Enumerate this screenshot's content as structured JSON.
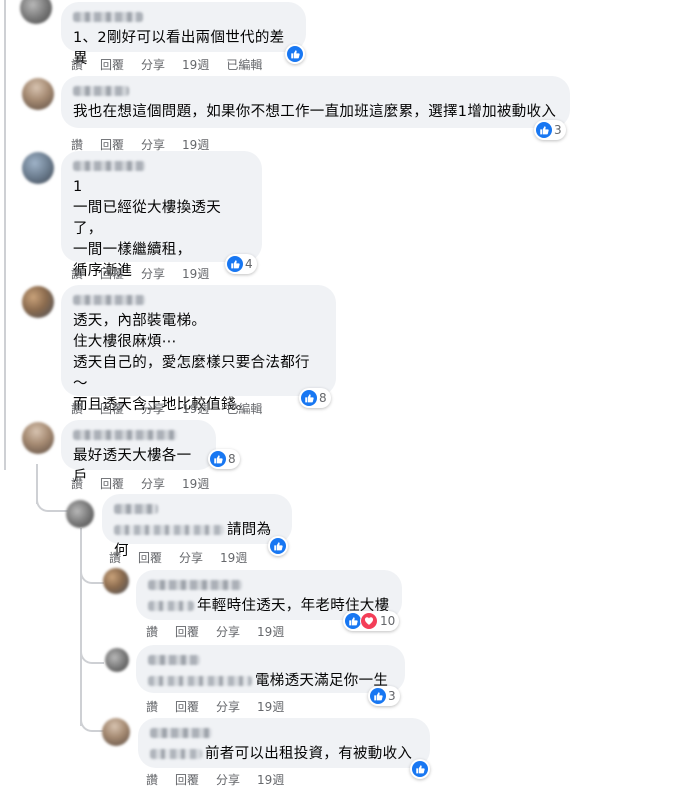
{
  "actions": {
    "like": "讚",
    "reply": "回覆",
    "share": "分享",
    "edited": "已編輯"
  },
  "comments": [
    {
      "time": "19週",
      "text": "1、2剛好可以看出兩個世代的差異",
      "reactions": "",
      "edited": true
    },
    {
      "time": "19週",
      "text": "我也在想這個問題，如果你不想工作一直加班這麼累，選擇1增加被動收入",
      "reactions": "3",
      "edited": false
    },
    {
      "time": "19週",
      "text": "1\n一間已經從大樓換透天了，\n一間一樣繼續租，\n循序漸進",
      "reactions": "4",
      "edited": false
    },
    {
      "time": "19週",
      "text": "透天，內部裝電梯。\n住大樓很麻煩⋯\n透天自己的，愛怎麼樣只要合法都行～\n而且透天含土地比較值錢。",
      "reactions": "8",
      "edited": true
    },
    {
      "time": "19週",
      "text": "最好透天大樓各一戶",
      "reactions": "8",
      "edited": false
    }
  ],
  "replies": [
    {
      "time": "19週",
      "text": "請問為何",
      "reactions": ""
    },
    {
      "time": "19週",
      "text": "年輕時住透天，年老時住大樓",
      "reactions": "10"
    },
    {
      "time": "19週",
      "text": "電梯透天滿足你一生",
      "reactions": "3"
    },
    {
      "time": "19週",
      "text": "前者可以出租投資，有被動收入",
      "reactions": ""
    }
  ],
  "colors": {
    "like": "#1877f2",
    "love": "#f33e58",
    "bubble": "#f0f2f5",
    "meta": "#65676b"
  },
  "icons": {
    "like": "thumbs-up-icon",
    "love": "heart-icon"
  }
}
